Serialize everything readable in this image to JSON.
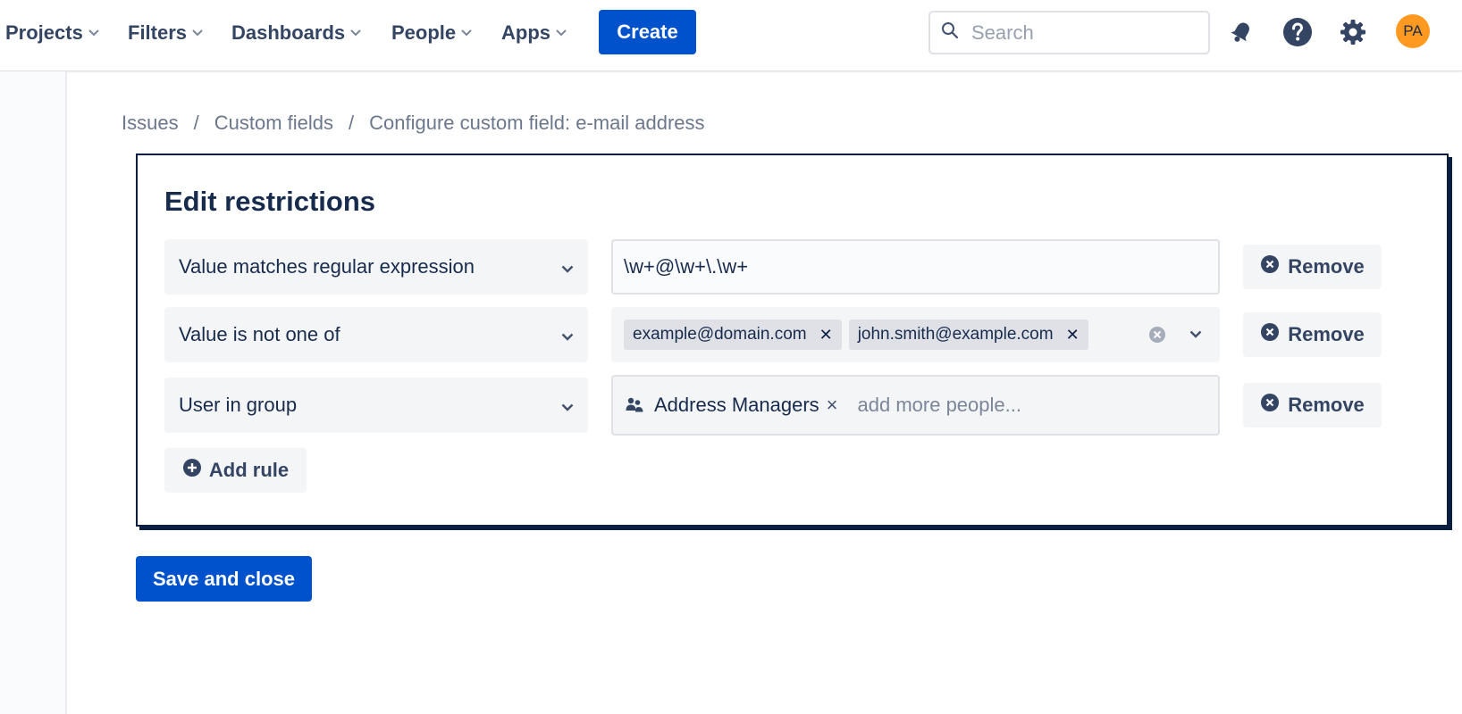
{
  "nav": {
    "items": [
      {
        "label": "Projects"
      },
      {
        "label": "Filters"
      },
      {
        "label": "Dashboards"
      },
      {
        "label": "People"
      },
      {
        "label": "Apps"
      }
    ],
    "create_label": "Create",
    "search_placeholder": "Search",
    "avatar_initials": "PA",
    "icons": [
      "notifications-icon",
      "help-icon",
      "settings-icon"
    ]
  },
  "breadcrumb": [
    "Issues",
    "Custom fields",
    "Configure custom field: e-mail address"
  ],
  "panel": {
    "title": "Edit restrictions",
    "rules": [
      {
        "type": "Value matches regular expression",
        "value": "\\w+@\\w+\\.\\w+",
        "remove_label": "Remove"
      },
      {
        "type": "Value is not one of",
        "tags": [
          "example@domain.com",
          "john.smith@example.com"
        ],
        "remove_label": "Remove"
      },
      {
        "type": "User in group",
        "group": "Address Managers",
        "group_remove": "×",
        "people_placeholder": "add more people...",
        "remove_label": "Remove"
      }
    ],
    "add_rule_label": "Add rule"
  },
  "save_label": "Save and close",
  "colors": {
    "primary": "#0052cc",
    "text": "#172b4d",
    "avatar": "#ff991f"
  }
}
